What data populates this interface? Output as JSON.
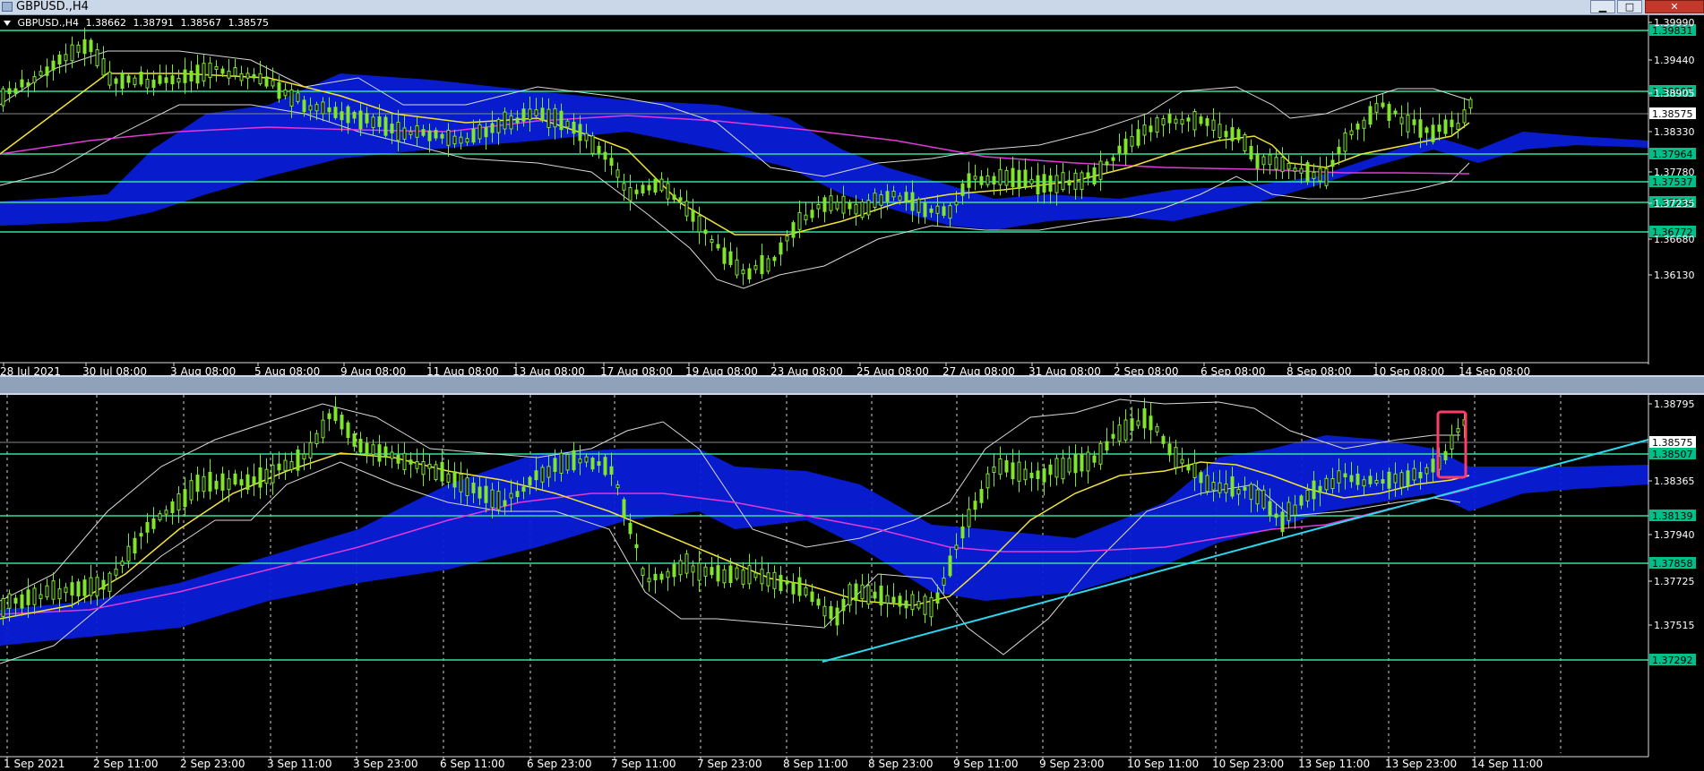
{
  "window": {
    "title": "GBPUSD.,H4",
    "buttons": {
      "minimize": "▁",
      "maximize": "□",
      "close": "✕"
    }
  },
  "top_chart": {
    "symbol": "GBPUSD.,H4",
    "ohlc": [
      "1.38662",
      "1.38791",
      "1.38567",
      "1.38575"
    ],
    "price_scale": [
      "1.39990",
      "1.39440",
      "1.38905",
      "1.38330",
      "1.37780",
      "1.37235",
      "1.36680",
      "1.36130"
    ],
    "level_labels": [
      "1.39831",
      "1.38907",
      "1.37964",
      "1.37537",
      "1.37234",
      "1.36772"
    ],
    "current_price": "1.38575",
    "time_labels": [
      "28 Jul 2021",
      "30 Jul 08:00",
      "3 Aug 08:00",
      "5 Aug 08:00",
      "9 Aug 08:00",
      "11 Aug 08:00",
      "13 Aug 08:00",
      "17 Aug 08:00",
      "19 Aug 08:00",
      "23 Aug 08:00",
      "25 Aug 08:00",
      "27 Aug 08:00",
      "31 Aug 08:00",
      "2 Sep 08:00",
      "6 Sep 08:00",
      "8 Sep 08:00",
      "10 Sep 08:00",
      "14 Sep 08:00"
    ]
  },
  "bottom_chart": {
    "price_scale": [
      "1.38795",
      "1.38365",
      "1.37940",
      "1.37725",
      "1.37515"
    ],
    "level_labels": [
      "1.38507",
      "1.38139",
      "1.37858",
      "1.37292"
    ],
    "current_price": "1.38575",
    "time_labels": [
      "1 Sep 2021",
      "2 Sep 11:00",
      "2 Sep 23:00",
      "3 Sep 11:00",
      "3 Sep 23:00",
      "6 Sep 11:00",
      "6 Sep 23:00",
      "7 Sep 11:00",
      "7 Sep 23:00",
      "8 Sep 11:00",
      "8 Sep 23:00",
      "9 Sep 11:00",
      "9 Sep 23:00",
      "10 Sep 11:00",
      "10 Sep 23:00",
      "13 Sep 11:00",
      "13 Sep 23:00",
      "14 Sep 11:00"
    ]
  },
  "colors": {
    "background": "#000000",
    "level_line": "#33e09a",
    "label_bg": "#00c08a",
    "cloud": "#0a1ed8",
    "ma_fast": "#f2e23a",
    "ma_slow": "#e03ad8",
    "bands": "#d8d8d8",
    "candle": "#7fe62d",
    "trendline": "#2ad8f0",
    "highlight": "#ff3b6b"
  }
}
